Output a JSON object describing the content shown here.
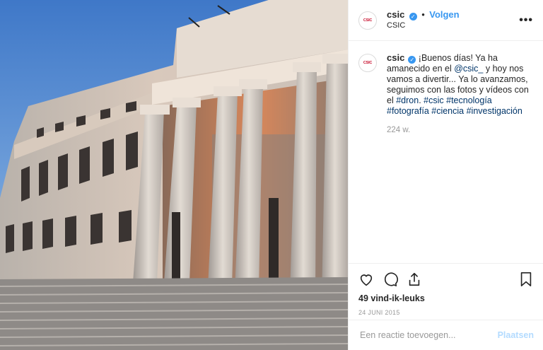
{
  "photo": {
    "alt": ""
  },
  "header": {
    "avatar_text": "CSIC",
    "username": "csic",
    "verified_mark": "✓",
    "separator": "•",
    "follow_label": "Volgen",
    "location": "CSIC",
    "more_label": "•••"
  },
  "caption": {
    "username": "csic",
    "text_1": "¡Buenos días! Ya ha amanecido en el ",
    "mention": "@csic_",
    "text_2": " y hoy nos vamos a divertir... Ya lo avanzamos, seguimos con las fotos y vídeos con el ",
    "tag_dron": "#dron",
    "text_3": ".",
    "tags": [
      "#csic",
      "#tecnología",
      "#fotografía",
      "#ciencia",
      "#investigación"
    ],
    "age": "224 w."
  },
  "actions": {
    "like_icon": "heart-icon",
    "comment_icon": "comment-icon",
    "share_icon": "share-icon",
    "save_icon": "bookmark-icon",
    "likes": "49 vind-ik-leuks",
    "date": "24 JUNI 2015"
  },
  "comment_box": {
    "placeholder": "Een reactie toevoegen...",
    "post_label": "Plaatsen"
  },
  "colors": {
    "link": "#003569",
    "accent": "#3897f0",
    "post_disabled": "#b3dbff"
  }
}
